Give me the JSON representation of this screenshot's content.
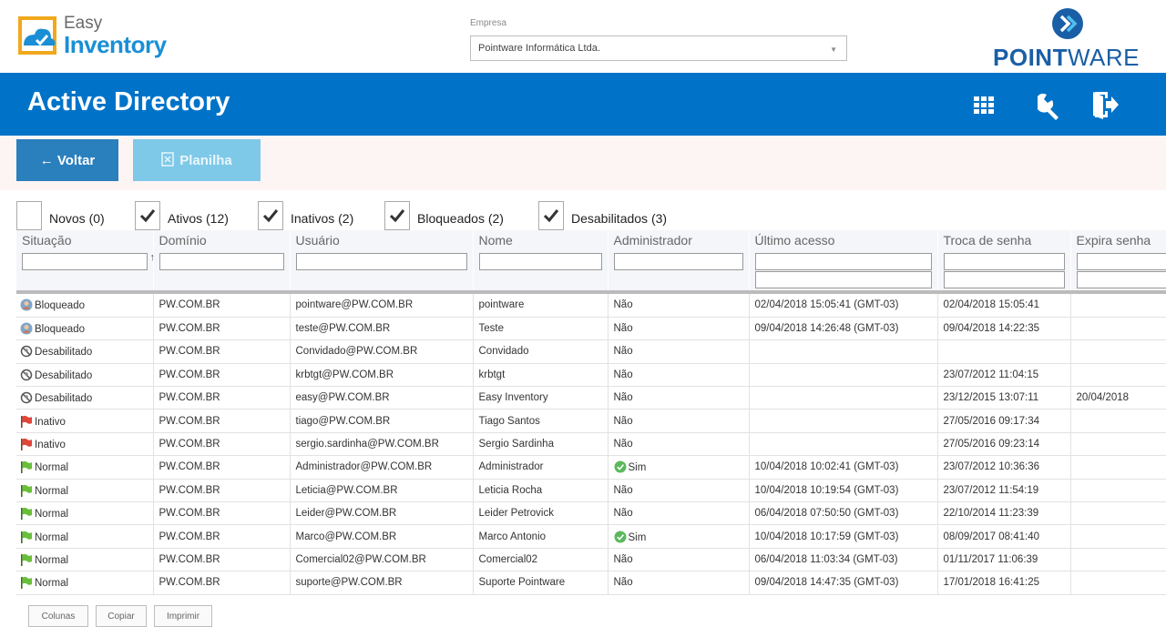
{
  "branding": {
    "app_name_line1": "Easy",
    "app_name_line2": "Inventory",
    "company_logo_bold": "POINT",
    "company_logo_rest": "WARE"
  },
  "empresa": {
    "label": "Empresa",
    "selected": "Pointware Informática Ltda."
  },
  "header": {
    "title": "Active Directory",
    "icons": [
      "grid-icon",
      "wrench-icon",
      "logout-icon"
    ]
  },
  "toolbar": {
    "back_label": "← Voltar",
    "planilha_label": "Planilha"
  },
  "filters": [
    {
      "label": "Novos (0)",
      "checked": false
    },
    {
      "label": "Ativos (12)",
      "checked": true
    },
    {
      "label": "Inativos (2)",
      "checked": true
    },
    {
      "label": "Bloqueados (2)",
      "checked": true
    },
    {
      "label": "Desabilitados (3)",
      "checked": true
    }
  ],
  "table": {
    "columns": [
      "Situação",
      "Domínio",
      "Usuário",
      "Nome",
      "Administrador",
      "Último acesso",
      "Troca de senha",
      "Expira senha"
    ],
    "rows": [
      {
        "status": "Bloqueado",
        "status_icon": "user-locked-icon",
        "domain": "PW.COM.BR",
        "user": "pointware@PW.COM.BR",
        "name": "pointware",
        "admin": "Não",
        "admin_icon": "",
        "last": "02/04/2018 15:05:41 (GMT-03)",
        "pwd": "02/04/2018 15:05:41",
        "exp": ""
      },
      {
        "status": "Bloqueado",
        "status_icon": "user-locked-icon",
        "domain": "PW.COM.BR",
        "user": "teste@PW.COM.BR",
        "name": "Teste",
        "admin": "Não",
        "admin_icon": "",
        "last": "09/04/2018 14:26:48 (GMT-03)",
        "pwd": "09/04/2018 14:22:35",
        "exp": ""
      },
      {
        "status": "Desabilitado",
        "status_icon": "disabled-icon",
        "domain": "PW.COM.BR",
        "user": "Convidado@PW.COM.BR",
        "name": "Convidado",
        "admin": "Não",
        "admin_icon": "",
        "last": "",
        "pwd": "",
        "exp": ""
      },
      {
        "status": "Desabilitado",
        "status_icon": "disabled-icon",
        "domain": "PW.COM.BR",
        "user": "krbtgt@PW.COM.BR",
        "name": "krbtgt",
        "admin": "Não",
        "admin_icon": "",
        "last": "",
        "pwd": "23/07/2012 11:04:15",
        "exp": ""
      },
      {
        "status": "Desabilitado",
        "status_icon": "disabled-icon",
        "domain": "PW.COM.BR",
        "user": "easy@PW.COM.BR",
        "name": "Easy Inventory",
        "admin": "Não",
        "admin_icon": "",
        "last": "",
        "pwd": "23/12/2015 13:07:11",
        "exp": "20/04/2018"
      },
      {
        "status": "Inativo",
        "status_icon": "red-flag-icon",
        "domain": "PW.COM.BR",
        "user": "tiago@PW.COM.BR",
        "name": "Tiago Santos",
        "admin": "Não",
        "admin_icon": "",
        "last": "",
        "pwd": "27/05/2016 09:17:34",
        "exp": ""
      },
      {
        "status": "Inativo",
        "status_icon": "red-flag-icon",
        "domain": "PW.COM.BR",
        "user": "sergio.sardinha@PW.COM.BR",
        "name": "Sergio Sardinha",
        "admin": "Não",
        "admin_icon": "",
        "last": "",
        "pwd": "27/05/2016 09:23:14",
        "exp": ""
      },
      {
        "status": "Normal",
        "status_icon": "green-flag-icon",
        "domain": "PW.COM.BR",
        "user": "Administrador@PW.COM.BR",
        "name": "Administrador",
        "admin": "Sim",
        "admin_icon": "check-circle-icon",
        "last": "10/04/2018 10:02:41 (GMT-03)",
        "pwd": "23/07/2012 10:36:36",
        "exp": ""
      },
      {
        "status": "Normal",
        "status_icon": "green-flag-icon",
        "domain": "PW.COM.BR",
        "user": "Leticia@PW.COM.BR",
        "name": "Leticia Rocha",
        "admin": "Não",
        "admin_icon": "",
        "last": "10/04/2018 10:19:54 (GMT-03)",
        "pwd": "23/07/2012 11:54:19",
        "exp": ""
      },
      {
        "status": "Normal",
        "status_icon": "green-flag-icon",
        "domain": "PW.COM.BR",
        "user": "Leider@PW.COM.BR",
        "name": "Leider Petrovick",
        "admin": "Não",
        "admin_icon": "",
        "last": "06/04/2018 07:50:50 (GMT-03)",
        "pwd": "22/10/2014 11:23:39",
        "exp": ""
      },
      {
        "status": "Normal",
        "status_icon": "green-flag-icon",
        "domain": "PW.COM.BR",
        "user": "Marco@PW.COM.BR",
        "name": "Marco Antonio",
        "admin": "Sim",
        "admin_icon": "check-circle-icon",
        "last": "10/04/2018 10:17:59 (GMT-03)",
        "pwd": "08/09/2017 08:41:40",
        "exp": ""
      },
      {
        "status": "Normal",
        "status_icon": "green-flag-icon",
        "domain": "PW.COM.BR",
        "user": "Comercial02@PW.COM.BR",
        "name": "Comercial02",
        "admin": "Não",
        "admin_icon": "",
        "last": "06/04/2018 11:03:34 (GMT-03)",
        "pwd": "01/11/2017 11:06:39",
        "exp": ""
      },
      {
        "status": "Normal",
        "status_icon": "green-flag-icon",
        "domain": "PW.COM.BR",
        "user": "suporte@PW.COM.BR",
        "name": "Suporte Pointware",
        "admin": "Não",
        "admin_icon": "",
        "last": "09/04/2018 14:47:35 (GMT-03)",
        "pwd": "17/01/2018 16:41:25",
        "exp": ""
      }
    ]
  },
  "bottom_buttons": [
    "Colunas",
    "Copiar",
    "Imprimir"
  ],
  "colors": {
    "header_blue": "#0073c8",
    "button_blue": "#2a7fbd",
    "button_light": "#7ec9e8",
    "brand_blue": "#1a8fd6"
  }
}
